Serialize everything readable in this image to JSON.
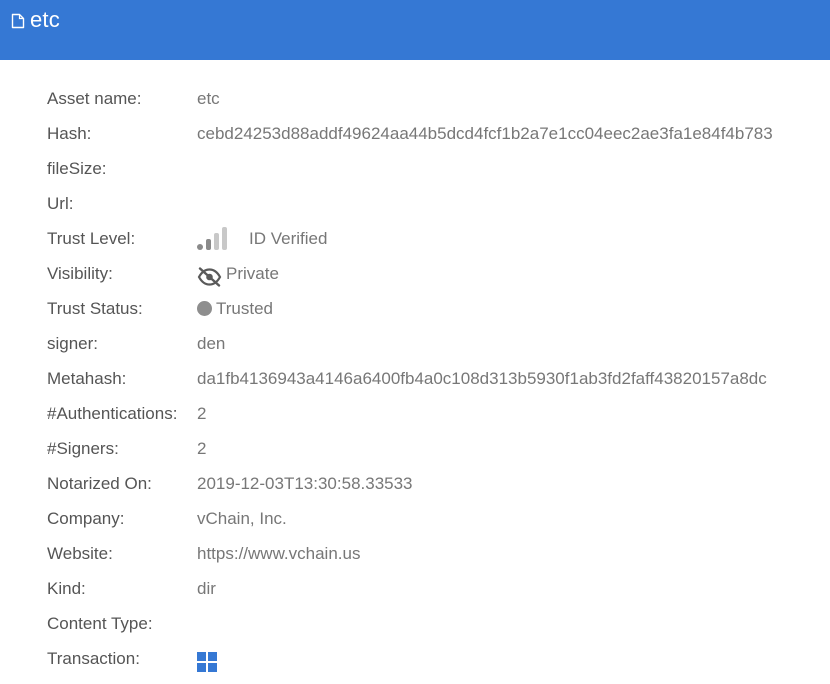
{
  "header": {
    "icon": "document-icon",
    "title": "etc",
    "background": "#3578d4"
  },
  "details": {
    "asset_name": {
      "label": "Asset name:",
      "value": "etc"
    },
    "hash": {
      "label": "Hash:",
      "value": "cebd24253d88addf49624aa44b5dcd4fcf1b2a7e1cc04eec2ae3fa1e84f4b783"
    },
    "file_size": {
      "label": "fileSize:",
      "value": ""
    },
    "url": {
      "label": "Url:",
      "value": ""
    },
    "trust_level": {
      "label": "Trust Level:",
      "value": "ID Verified",
      "icon": "signal-strength-icon",
      "level_bars": 2,
      "total_bars": 4
    },
    "visibility": {
      "label": "Visibility:",
      "value": "Private",
      "icon": "eye-off-icon"
    },
    "trust_status": {
      "label": "Trust Status:",
      "value": "Trusted",
      "icon": "status-dot-icon",
      "color": "#8e8e8e"
    },
    "signer": {
      "label": "signer:",
      "value": "den"
    },
    "metahash": {
      "label": "Metahash:",
      "value": "da1fb4136943a4146a6400fb4a0c108d313b5930f1ab3fd2faff43820157a8dc"
    },
    "authentications": {
      "label": "#Authentications:",
      "value": "2"
    },
    "signers": {
      "label": "#Signers:",
      "value": "2"
    },
    "notarized_on": {
      "label": "Notarized On:",
      "value": "2019-12-03T13:30:58.33533"
    },
    "company": {
      "label": "Company:",
      "value": "vChain, Inc."
    },
    "website": {
      "label": "Website:",
      "value": "https://www.vchain.us"
    },
    "kind": {
      "label": "Kind:",
      "value": "dir"
    },
    "content_type": {
      "label": "Content Type:",
      "value": ""
    },
    "transaction": {
      "label": "Transaction:",
      "icon": "windows-grid-icon",
      "color": "#3578d4"
    }
  }
}
